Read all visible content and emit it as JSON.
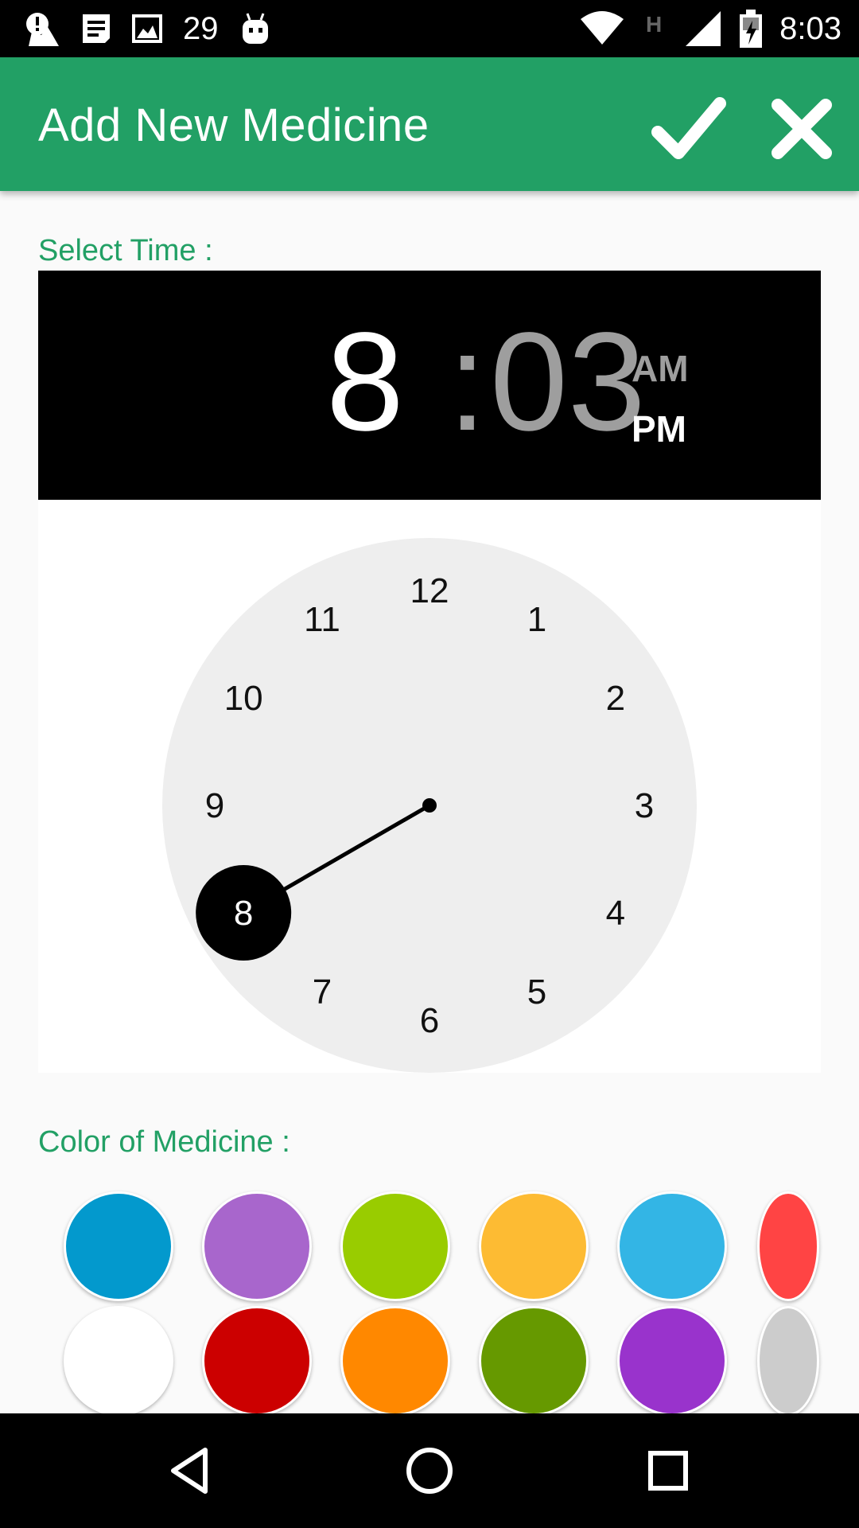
{
  "status_bar": {
    "notification_count": "29",
    "time": "8:03",
    "network_label": "H",
    "icons": [
      "alert-icon",
      "news-icon",
      "image-icon",
      "android-icon",
      "wifi-icon",
      "signal-icon",
      "battery-charging-icon"
    ]
  },
  "app_bar": {
    "title": "Add New Medicine",
    "confirm_icon": "check-icon",
    "close_icon": "close-icon",
    "color": "#22a065"
  },
  "time_section": {
    "label": "Select Time :",
    "hour": "8",
    "separator": ":",
    "minute": "03",
    "am_label": "AM",
    "pm_label": "PM",
    "selected_period": "PM"
  },
  "clock": {
    "numbers": [
      "12",
      "1",
      "2",
      "3",
      "4",
      "5",
      "6",
      "7",
      "8",
      "9",
      "10",
      "11"
    ],
    "selected": "8"
  },
  "color_section": {
    "label": "Color of Medicine  :",
    "swatches": [
      "#0399cd",
      "#a866cc",
      "#99cc00",
      "#fdbb33",
      "#33b5e5",
      "#ff4444",
      "#ffffff",
      "#cc0000",
      "#ff8800",
      "#669900",
      "#9933cc",
      "#cccccc"
    ]
  },
  "nav_bar": {
    "icons": [
      "back-icon",
      "home-icon",
      "recents-icon"
    ]
  }
}
